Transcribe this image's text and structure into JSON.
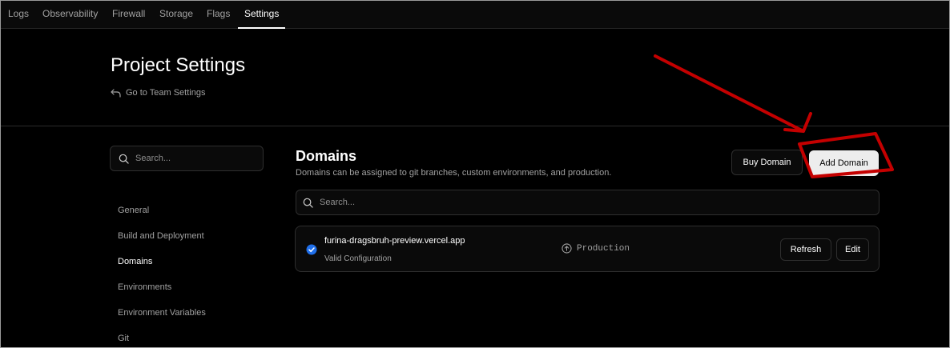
{
  "topnav": {
    "tabs": [
      {
        "label": "Logs"
      },
      {
        "label": "Observability"
      },
      {
        "label": "Firewall"
      },
      {
        "label": "Storage"
      },
      {
        "label": "Flags"
      },
      {
        "label": "Settings",
        "active": true
      }
    ]
  },
  "header": {
    "title": "Project Settings",
    "back_link": "Go to Team Settings",
    "back_icon": "return-arrow-icon"
  },
  "sidebar": {
    "search_placeholder": "Search...",
    "items": [
      {
        "label": "General"
      },
      {
        "label": "Build and Deployment"
      },
      {
        "label": "Domains",
        "active": true
      },
      {
        "label": "Environments"
      },
      {
        "label": "Environment Variables"
      },
      {
        "label": "Git"
      }
    ]
  },
  "domains": {
    "title": "Domains",
    "description": "Domains can be assigned to git branches, custom environments, and production.",
    "buy_label": "Buy Domain",
    "add_label": "Add Domain",
    "search_placeholder": "Search...",
    "list": [
      {
        "name": "furina-dragsbruh-preview.vercel.app",
        "status": "Valid Configuration",
        "environment": "Production",
        "refresh_label": "Refresh",
        "edit_label": "Edit"
      }
    ]
  },
  "colors": {
    "background": "#000000",
    "accent_blue": "#1f6feb",
    "annotation_red": "#c40000"
  }
}
